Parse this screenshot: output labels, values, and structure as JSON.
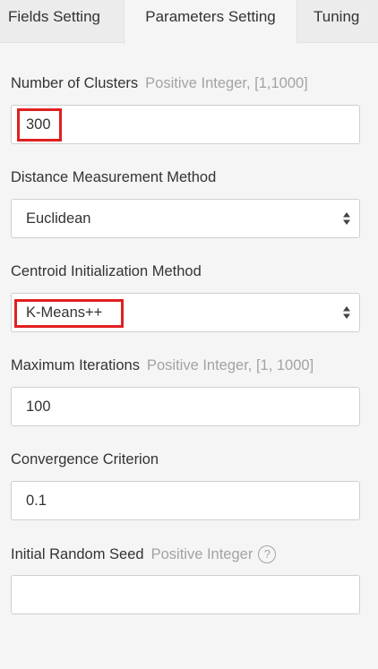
{
  "tabs": {
    "fields": "Fields Setting",
    "parameters": "Parameters Setting",
    "tuning": "Tuning"
  },
  "form": {
    "num_clusters": {
      "label": "Number of Clusters",
      "hint": "Positive Integer, [1,1000]",
      "value": "300"
    },
    "distance_method": {
      "label": "Distance Measurement Method",
      "value": "Euclidean"
    },
    "centroid_init": {
      "label": "Centroid Initialization Method",
      "value": "K-Means++"
    },
    "max_iterations": {
      "label": "Maximum Iterations",
      "hint": "Positive Integer, [1, 1000]",
      "value": "100"
    },
    "convergence": {
      "label": "Convergence Criterion",
      "value": "0.1"
    },
    "random_seed": {
      "label": "Initial Random Seed",
      "hint": "Positive Integer",
      "help_glyph": "?",
      "value": ""
    }
  },
  "colors": {
    "highlight": "#e02020",
    "hint_text": "#a3a3a3",
    "tab_bar": "#ececec",
    "panel": "#f5f5f5"
  },
  "icons": {
    "select_arrow": "sort-arrows-icon",
    "help": "question-circle-icon"
  }
}
